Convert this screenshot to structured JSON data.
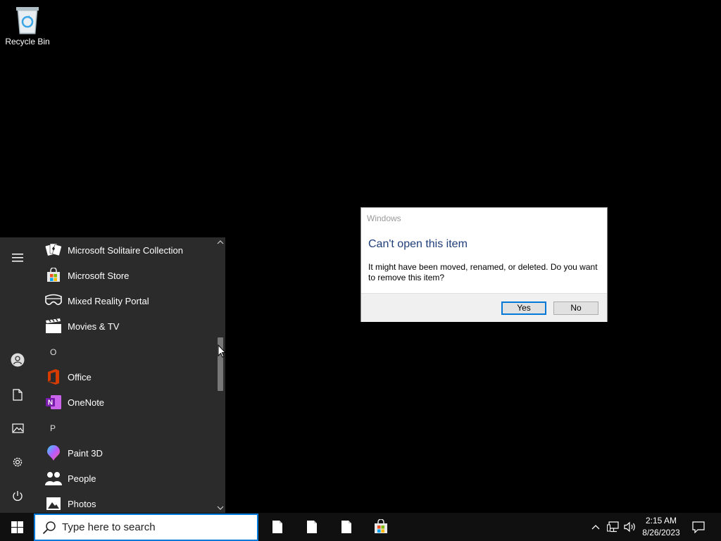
{
  "desktop": {
    "icons": [
      {
        "label": "Recycle Bin",
        "icon": "recycle-bin-icon"
      }
    ]
  },
  "start_menu": {
    "rail": [
      {
        "name": "expand",
        "icon": "hamburger-icon"
      },
      {
        "name": "account",
        "icon": "user-icon"
      },
      {
        "name": "documents",
        "icon": "document-icon"
      },
      {
        "name": "pictures",
        "icon": "pictures-icon"
      },
      {
        "name": "settings",
        "icon": "gear-icon"
      },
      {
        "name": "power",
        "icon": "power-icon"
      }
    ],
    "apps": [
      {
        "label": "Microsoft Solitaire Collection",
        "icon": "solitaire-icon"
      },
      {
        "label": "Microsoft Store",
        "icon": "store-icon"
      },
      {
        "label": "Mixed Reality Portal",
        "icon": "mixed-reality-icon"
      },
      {
        "label": "Movies & TV",
        "icon": "movies-icon"
      },
      {
        "label": "Office",
        "icon": "office-icon"
      },
      {
        "label": "OneNote",
        "icon": "onenote-icon"
      },
      {
        "label": "Paint 3D",
        "icon": "paint3d-icon"
      },
      {
        "label": "People",
        "icon": "people-icon"
      },
      {
        "label": "Photos",
        "icon": "photos-icon"
      }
    ],
    "letters": [
      "O",
      "P"
    ]
  },
  "dialog": {
    "title": "Windows",
    "heading": "Can't open this item",
    "message": "It might have been moved, renamed, or deleted. Do you want to remove this item?",
    "yes_label": "Yes",
    "no_label": "No"
  },
  "taskbar": {
    "search_placeholder": "Type here to search",
    "pinned": [
      "file-icon",
      "file-icon",
      "file-icon",
      "store-icon"
    ],
    "time": "2:15 AM",
    "date": "8/26/2023",
    "tray_icons": [
      "chevron-up-icon",
      "network-icon",
      "volume-icon",
      "action-center-icon"
    ]
  },
  "colors": {
    "accent": "#0078d7",
    "start_bg": "#2b2b2b",
    "dialog_heading": "#1f3d7a"
  }
}
